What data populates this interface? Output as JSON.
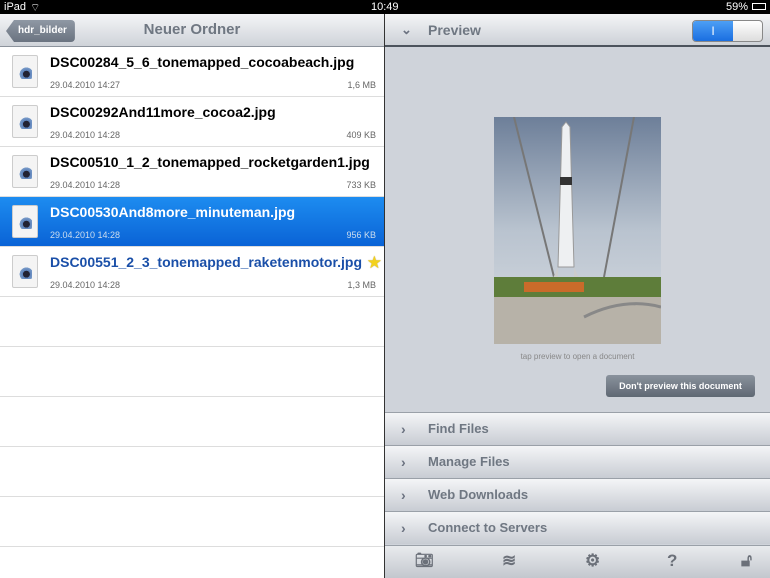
{
  "status": {
    "device": "iPad",
    "time": "10:49",
    "battery": "59%"
  },
  "nav": {
    "back": "hdr_bilder",
    "title": "Neuer Ordner"
  },
  "files": [
    {
      "name": "DSC00284_5_6_tonemapped_cocoabeach.jpg",
      "date": "29.04.2010 14:27",
      "size": "1,6 MB"
    },
    {
      "name": "DSC00292And11more_cocoa2.jpg",
      "date": "29.04.2010 14:28",
      "size": "409 KB"
    },
    {
      "name": "DSC00510_1_2_tonemapped_rocketgarden1.jpg",
      "date": "29.04.2010 14:28",
      "size": "733 KB"
    },
    {
      "name": "DSC00530And8more_minuteman.jpg",
      "date": "29.04.2010 14:28",
      "size": "956 KB",
      "selected": true
    },
    {
      "name": "DSC00551_2_3_tonemapped_raketenmotor.jpg",
      "date": "29.04.2010 14:28",
      "size": "1,3 MB",
      "starred": true
    }
  ],
  "preview": {
    "title": "Preview",
    "toggle": "I",
    "hint": "tap preview to open a document",
    "button": "Don't preview this document"
  },
  "sections": [
    "Find Files",
    "Manage Files",
    "Web Downloads",
    "Connect to Servers"
  ],
  "toolbar": [
    "camera-icon",
    "wifi-icon",
    "gear-icon",
    "help-icon",
    "unlock-icon"
  ]
}
